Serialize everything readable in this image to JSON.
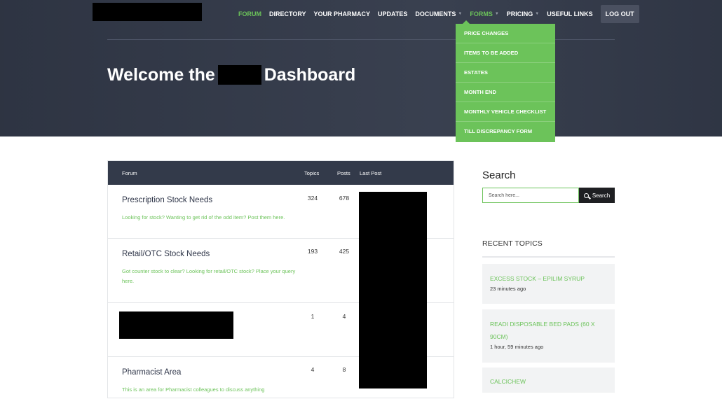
{
  "nav": {
    "items": [
      {
        "label": "FORUM",
        "active": true,
        "caret": false
      },
      {
        "label": "DIRECTORY",
        "active": false,
        "caret": false
      },
      {
        "label": "YOUR PHARMACY",
        "active": false,
        "caret": false
      },
      {
        "label": "UPDATES",
        "active": false,
        "caret": false
      },
      {
        "label": "DOCUMENTS",
        "active": false,
        "caret": true
      },
      {
        "label": "FORMS",
        "active": true,
        "caret": true
      },
      {
        "label": "PRICING",
        "active": false,
        "caret": true
      },
      {
        "label": "USEFUL LINKS",
        "active": false,
        "caret": false
      }
    ],
    "logout_label": "LOG OUT"
  },
  "forms_dropdown": {
    "items": [
      "PRICE CHANGES",
      "ITEMS TO BE ADDED",
      "ESTATES",
      "MONTH END",
      "MONTHLY VEHICLE CHECKLIST",
      "TILL DISCREPANCY FORM"
    ]
  },
  "hero": {
    "title_before": "Welcome the",
    "title_after": "Dashboard"
  },
  "forum": {
    "headers": {
      "forum": "Forum",
      "topics": "Topics",
      "posts": "Posts",
      "last_post": "Last Post"
    },
    "rows": [
      {
        "title": "Prescription Stock Needs",
        "description": "Looking for stock? Wanting to get rid of the odd item? Post them here.",
        "topics": "324",
        "posts": "678"
      },
      {
        "title": "Retail/OTC Stock Needs",
        "description": "Got counter stock to clear? Looking for retail/OTC stock? Place your query here.",
        "topics": "193",
        "posts": "425"
      },
      {
        "title": "",
        "description": "",
        "topics": "1",
        "posts": "4"
      },
      {
        "title": "Pharmacist Area",
        "description": "This is an area for Pharmacist colleagues to discuss anything",
        "topics": "4",
        "posts": "8"
      }
    ]
  },
  "sidebar": {
    "search_title": "Search",
    "search_placeholder": "Search here...",
    "search_button": "Search",
    "recent_title": "RECENT TOPICS",
    "recent_topics": [
      {
        "title": "EXCESS STOCK – EPILIM SYRUP",
        "time": "23 minutes ago"
      },
      {
        "title": "READI DISPOSABLE BED PADS (60 X 90CM)",
        "time": "1 hour, 59 minutes ago"
      },
      {
        "title": "CALCICHEW",
        "time": ""
      }
    ]
  },
  "colors": {
    "accent": "#6cc35a",
    "hero_bg": "#333a4a",
    "table_head": "#333a4a",
    "button_dark": "#1e1f22"
  }
}
